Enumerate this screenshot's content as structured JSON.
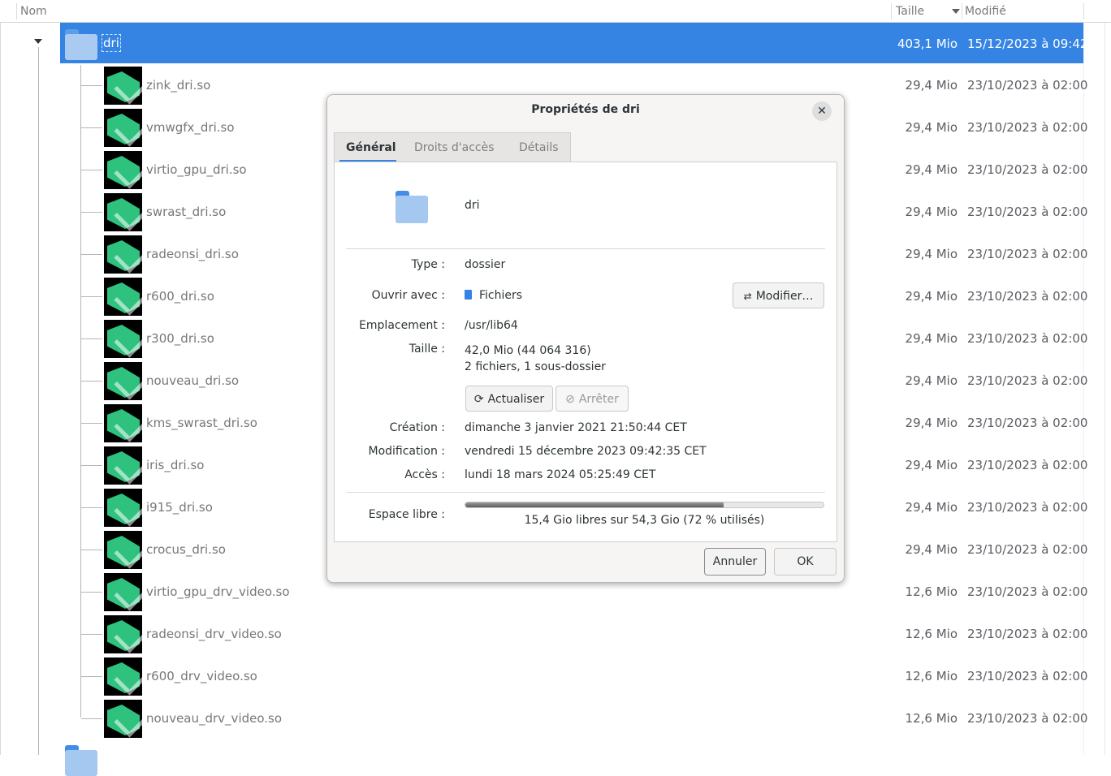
{
  "header": {
    "name": "Nom",
    "size": "Taille",
    "modified": "Modifié"
  },
  "selected": {
    "name": "dri",
    "size": "403,1 Mio",
    "modified": "15/12/2023 à 09:42"
  },
  "rows": [
    {
      "name": "zink_dri.so",
      "size": "29,4 Mio",
      "modified": "23/10/2023 à 02:00"
    },
    {
      "name": "vmwgfx_dri.so",
      "size": "29,4 Mio",
      "modified": "23/10/2023 à 02:00"
    },
    {
      "name": "virtio_gpu_dri.so",
      "size": "29,4 Mio",
      "modified": "23/10/2023 à 02:00"
    },
    {
      "name": "swrast_dri.so",
      "size": "29,4 Mio",
      "modified": "23/10/2023 à 02:00"
    },
    {
      "name": "radeonsi_dri.so",
      "size": "29,4 Mio",
      "modified": "23/10/2023 à 02:00"
    },
    {
      "name": "r600_dri.so",
      "size": "29,4 Mio",
      "modified": "23/10/2023 à 02:00"
    },
    {
      "name": "r300_dri.so",
      "size": "29,4 Mio",
      "modified": "23/10/2023 à 02:00"
    },
    {
      "name": "nouveau_dri.so",
      "size": "29,4 Mio",
      "modified": "23/10/2023 à 02:00"
    },
    {
      "name": "kms_swrast_dri.so",
      "size": "29,4 Mio",
      "modified": "23/10/2023 à 02:00"
    },
    {
      "name": "iris_dri.so",
      "size": "29,4 Mio",
      "modified": "23/10/2023 à 02:00"
    },
    {
      "name": "i915_dri.so",
      "size": "29,4 Mio",
      "modified": "23/10/2023 à 02:00"
    },
    {
      "name": "crocus_dri.so",
      "size": "29,4 Mio",
      "modified": "23/10/2023 à 02:00"
    },
    {
      "name": "virtio_gpu_drv_video.so",
      "size": "12,6 Mio",
      "modified": "23/10/2023 à 02:00"
    },
    {
      "name": "radeonsi_drv_video.so",
      "size": "12,6 Mio",
      "modified": "23/10/2023 à 02:00"
    },
    {
      "name": "r600_drv_video.so",
      "size": "12,6 Mio",
      "modified": "23/10/2023 à 02:00"
    },
    {
      "name": "nouveau_drv_video.so",
      "size": "12,6 Mio",
      "modified": "23/10/2023 à 02:00"
    }
  ],
  "dialog": {
    "title": "Propriétés de dri",
    "close_icon": "close-icon",
    "tabs": [
      "Général",
      "Droits d'accès",
      "Détails"
    ],
    "folder_name": "dri",
    "labels": {
      "type": "Type :",
      "open_with": "Ouvrir avec :",
      "location": "Emplacement :",
      "size": "Taille :",
      "created": "Création :",
      "modified": "Modification :",
      "accessed": "Accès :",
      "free_space": "Espace libre :"
    },
    "values": {
      "type": "dossier",
      "open_with": "Fichiers",
      "location": "/usr/lib64",
      "size": "42,0 Mio (44 064 316)",
      "contents": "2 fichiers, 1 sous-dossier",
      "created": "dimanche 3 janvier 2021 21:50:44 CET",
      "modified": "vendredi 15 décembre 2023 09:42:35 CET",
      "accessed": "lundi 18 mars 2024 05:25:49 CET",
      "free_space": "15,4 Gio libres sur 54,3 Gio (72 % utilisés)",
      "used_fraction": 0.72
    },
    "buttons": {
      "change": "Modifier…",
      "refresh": "Actualiser",
      "stop": "Arrêter",
      "cancel": "Annuler",
      "ok": "OK"
    }
  },
  "colors": {
    "accent": "#3584e4",
    "folder": "#a4c8f0",
    "lib_icon": "#2ec27e"
  }
}
